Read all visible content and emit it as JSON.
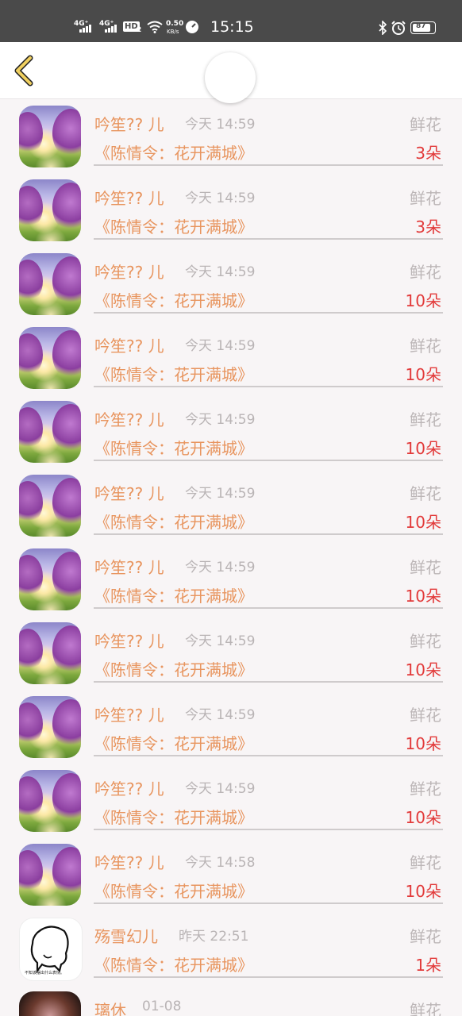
{
  "status_bar": {
    "net1": "4G⁺",
    "net2": "4G⁺",
    "hd": "HD",
    "hd_sub": "2",
    "speed_value": "0.50",
    "speed_unit": "KB/s",
    "time": "15:15",
    "battery": "87"
  },
  "header": {
    "back_icon": "chevron-left-icon"
  },
  "records": [
    {
      "name": "吟笙?? 儿",
      "time": "今天 14:59",
      "gift_type": "鲜花",
      "title": "《陈情令：花开满城》",
      "count": "3朵",
      "avatar": "lavender-field"
    },
    {
      "name": "吟笙?? 儿",
      "time": "今天 14:59",
      "gift_type": "鲜花",
      "title": "《陈情令：花开满城》",
      "count": "3朵",
      "avatar": "lavender-field"
    },
    {
      "name": "吟笙?? 儿",
      "time": "今天 14:59",
      "gift_type": "鲜花",
      "title": "《陈情令：花开满城》",
      "count": "10朵",
      "avatar": "lavender-field"
    },
    {
      "name": "吟笙?? 儿",
      "time": "今天 14:59",
      "gift_type": "鲜花",
      "title": "《陈情令：花开满城》",
      "count": "10朵",
      "avatar": "lavender-field"
    },
    {
      "name": "吟笙?? 儿",
      "time": "今天 14:59",
      "gift_type": "鲜花",
      "title": "《陈情令：花开满城》",
      "count": "10朵",
      "avatar": "lavender-field"
    },
    {
      "name": "吟笙?? 儿",
      "time": "今天 14:59",
      "gift_type": "鲜花",
      "title": "《陈情令：花开满城》",
      "count": "10朵",
      "avatar": "lavender-field"
    },
    {
      "name": "吟笙?? 儿",
      "time": "今天 14:59",
      "gift_type": "鲜花",
      "title": "《陈情令：花开满城》",
      "count": "10朵",
      "avatar": "lavender-field"
    },
    {
      "name": "吟笙?? 儿",
      "time": "今天 14:59",
      "gift_type": "鲜花",
      "title": "《陈情令：花开满城》",
      "count": "10朵",
      "avatar": "lavender-field"
    },
    {
      "name": "吟笙?? 儿",
      "time": "今天 14:59",
      "gift_type": "鲜花",
      "title": "《陈情令：花开满城》",
      "count": "10朵",
      "avatar": "lavender-field"
    },
    {
      "name": "吟笙?? 儿",
      "time": "今天 14:59",
      "gift_type": "鲜花",
      "title": "《陈情令：花开满城》",
      "count": "10朵",
      "avatar": "lavender-field"
    },
    {
      "name": "吟笙?? 儿",
      "time": "今天 14:58",
      "gift_type": "鲜花",
      "title": "《陈情令：花开满城》",
      "count": "10朵",
      "avatar": "lavender-field"
    },
    {
      "name": "殇雪幻儿",
      "time": "昨天 22:51",
      "gift_type": "鲜花",
      "title": "《陈情令：花开满城》",
      "count": "1朵",
      "avatar": "sketch-face",
      "avatar_caption": "不知该摆出什么表情。"
    },
    {
      "name": "璃休",
      "time": "01-08",
      "gift_type": "鲜花",
      "title": "",
      "count": "",
      "avatar": "portrait"
    }
  ],
  "colors": {
    "name": "#e8955f",
    "time": "#b9b4b5",
    "count": "#e23a3a",
    "status_bar_bg": "#4a4a4a",
    "back_chevron": "#f0d060"
  }
}
